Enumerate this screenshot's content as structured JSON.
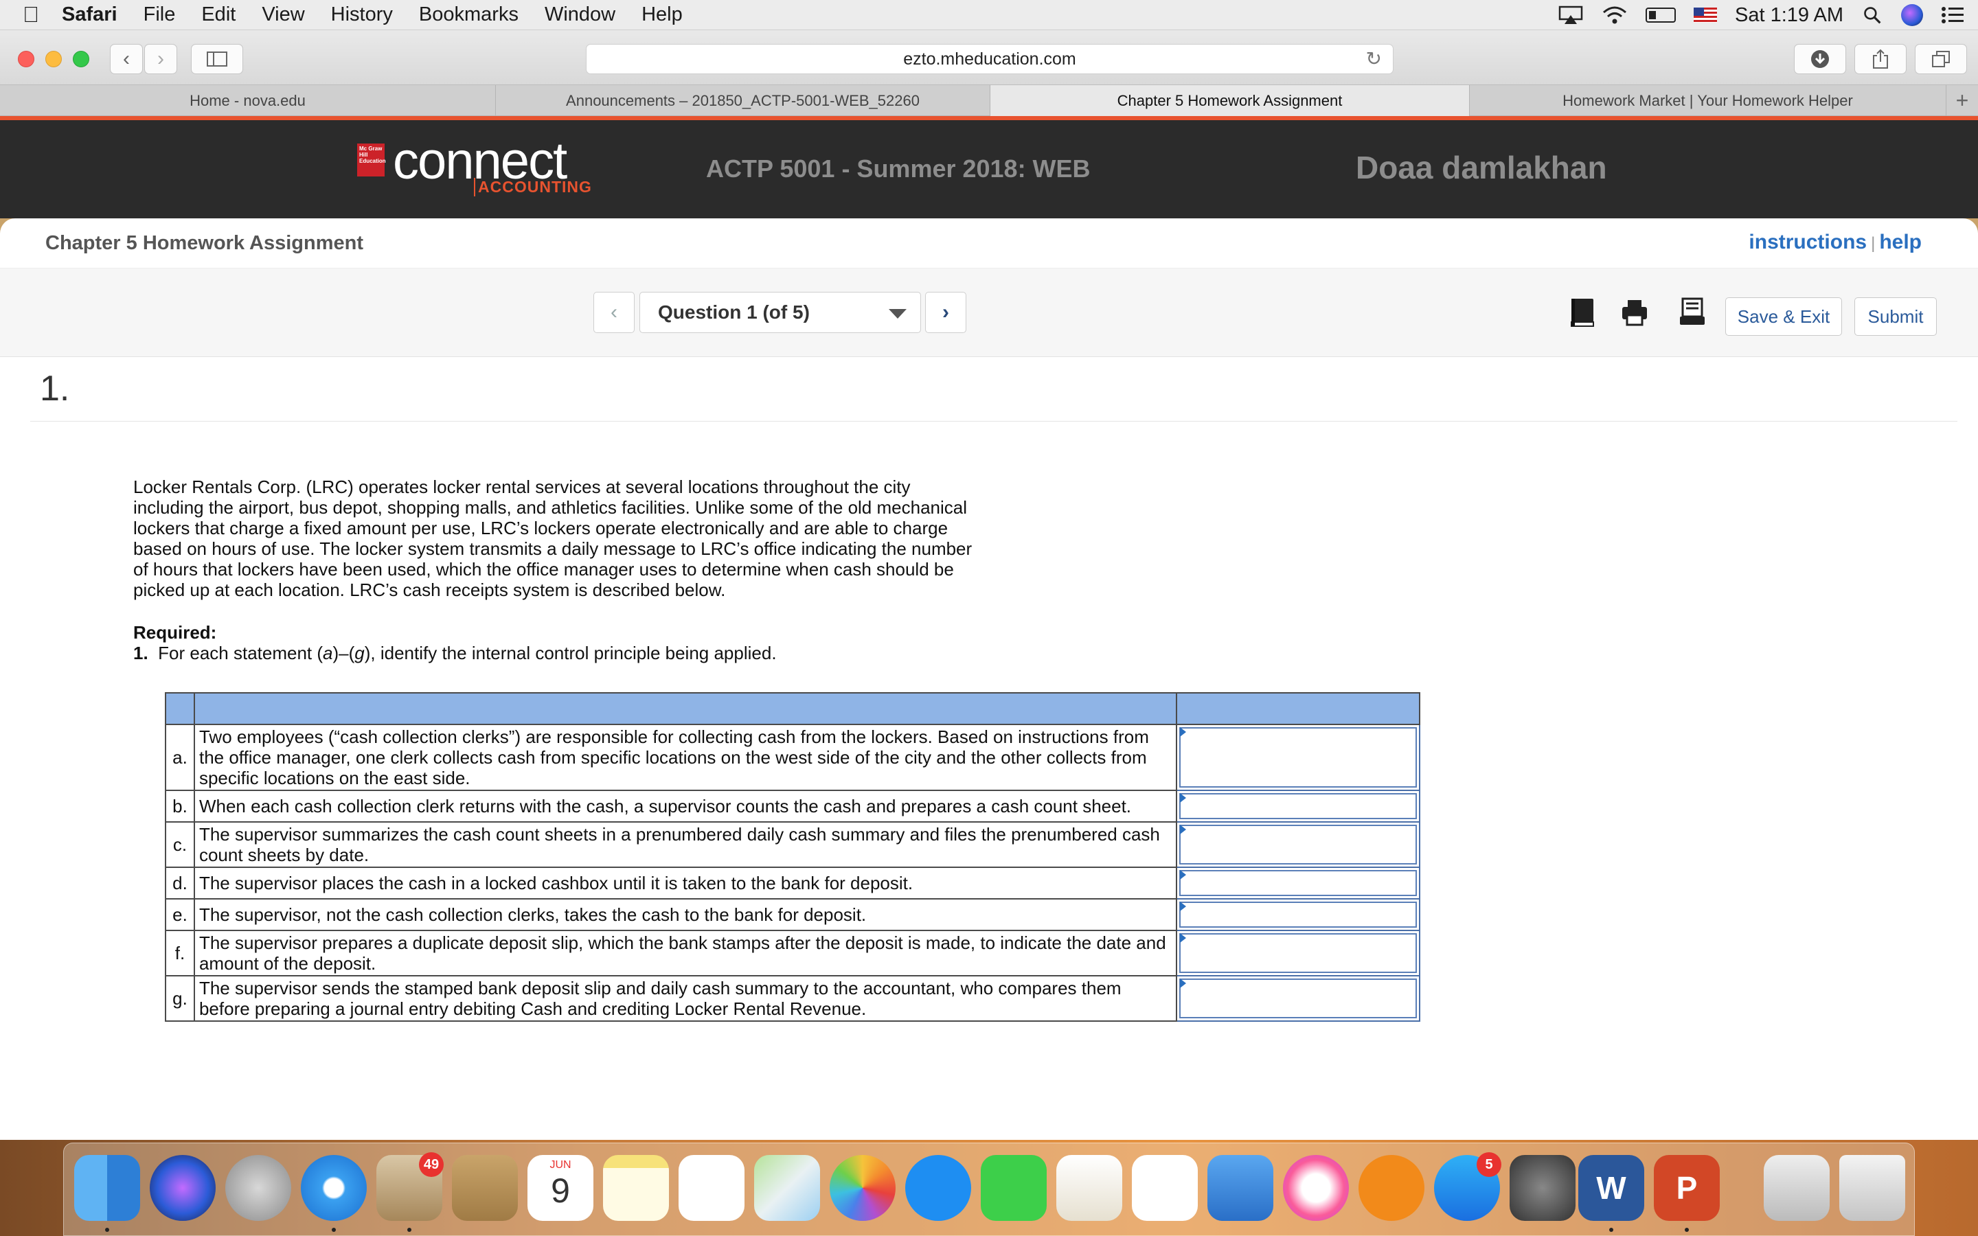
{
  "menubar": {
    "apple": "",
    "items": [
      "Safari",
      "File",
      "Edit",
      "View",
      "History",
      "Bookmarks",
      "Window",
      "Help"
    ],
    "clock": "Sat 1:19 AM",
    "status_icons": [
      "airplay-icon",
      "wifi-icon",
      "battery-icon",
      "us-flag-icon",
      "spotlight-icon",
      "siri-icon",
      "notification-center-icon"
    ]
  },
  "browser": {
    "url": "ezto.mheducation.com",
    "tabs": [
      {
        "label": "Home - nova.edu"
      },
      {
        "label": "Announcements – 201850_ACTP-5001-WEB_52260"
      },
      {
        "label": "Chapter 5 Homework Assignment"
      },
      {
        "label": "Homework Market | Your Homework Helper"
      }
    ],
    "new_tab": "+"
  },
  "header": {
    "logo_mh": "Mc Graw Hill Education",
    "logo_connect": "connect",
    "logo_accounting": "ACCOUNTING",
    "course": "ACTP 5001 - Summer 2018: WEB",
    "student": "Doaa damlakhan"
  },
  "assignment": {
    "title": "Chapter 5 Homework Assignment",
    "instructions_link": "instructions",
    "separator": "|",
    "help_link": "help"
  },
  "nav": {
    "prev": "‹",
    "next": "›",
    "question_select": "Question 1 (of 5)",
    "save_exit": "Save & Exit",
    "submit": "Submit"
  },
  "question": {
    "number": "1.",
    "body": "Locker Rentals Corp. (LRC) operates locker rental services at several locations throughout the city including the airport, bus depot, shopping malls, and athletics facilities. Unlike some of the old mechanical lockers that charge a fixed amount per use, LRC’s lockers operate electronically and are able to charge based on hours of use. The locker system transmits a daily message to LRC’s office indicating the number of hours that lockers have been used, which the office manager uses to determine when cash should be picked up at each location. LRC’s cash receipts system is described below.",
    "required_label": "Required:",
    "required_num": "1.",
    "required_text_pre": "For each statement (",
    "required_a": "a",
    "required_dash": ")–(",
    "required_g": "g",
    "required_text_post": "), identify the internal control principle being applied."
  },
  "table": {
    "rows": [
      {
        "letter": "a.",
        "text": "Two employees (“cash collection clerks”) are responsible for collecting cash from the lockers. Based on instructions from the office manager, one clerk collects cash from specific locations on the west side of the city and the other collects from specific locations on the east side."
      },
      {
        "letter": "b.",
        "text": "When each cash collection clerk returns with the cash, a supervisor counts the cash and prepares a cash count sheet."
      },
      {
        "letter": "c.",
        "text": "The supervisor summarizes the cash count sheets in a prenumbered daily cash summary and files the prenumbered cash count sheets by date."
      },
      {
        "letter": "d.",
        "text": "The supervisor places the cash in a locked cashbox until it is taken to the bank for deposit."
      },
      {
        "letter": "e.",
        "text": "The supervisor, not the cash collection clerks, takes the cash to the bank for deposit."
      },
      {
        "letter": "f.",
        "text": "The supervisor prepares a duplicate deposit slip, which the bank stamps after the deposit is made, to indicate the date and amount of the deposit."
      },
      {
        "letter": "g.",
        "text": "The supervisor sends the stamped bank deposit slip and daily cash summary to the accountant, who compares them before preparing a journal entry debiting Cash and crediting Locker Rental Revenue."
      }
    ]
  },
  "dock": {
    "mail_badge": "49",
    "calendar_month": "JUN",
    "calendar_day": "9",
    "appstore_badge": "5",
    "word_letter": "W",
    "ppt_letter": "P"
  },
  "colors": {
    "accent_orange": "#e8532f",
    "link_blue": "#2a6fbf",
    "table_header": "#8fb4e6"
  }
}
